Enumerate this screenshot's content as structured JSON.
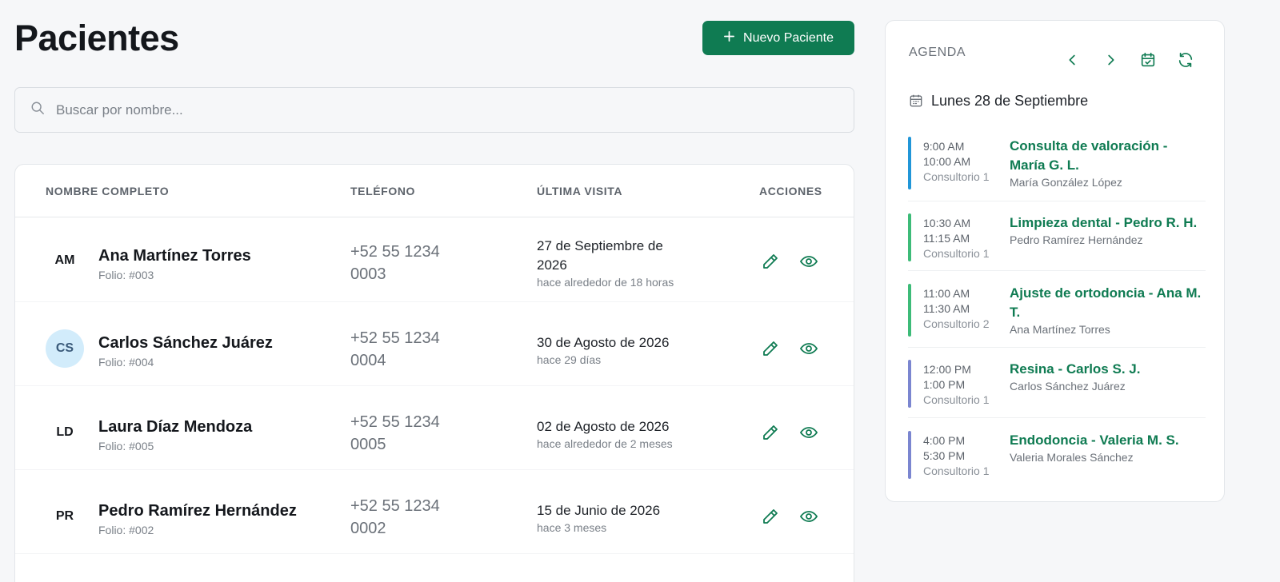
{
  "header": {
    "title": "Pacientes",
    "new_button_label": "Nuevo Paciente"
  },
  "search": {
    "placeholder": "Buscar por nombre...",
    "value": ""
  },
  "table": {
    "columns": [
      "NOMBRE COMPLETO",
      "TELÉFONO",
      "ÚLTIMA VISITA",
      "ACCIONES"
    ],
    "rows": [
      {
        "initials": "AM",
        "name": "Ana Martínez Torres",
        "folio": "Folio: #003",
        "phone_line1": "+52 55 1234",
        "phone_line2": "0003",
        "last_visit": "27 de Septiembre de 2026",
        "ago": "hace alrededor de 18 horas"
      },
      {
        "initials": "CS",
        "name": "Carlos Sánchez Juárez",
        "folio": "Folio: #004",
        "phone_line1": "+52 55 1234",
        "phone_line2": "0004",
        "last_visit": "30 de Agosto de 2026",
        "ago": "hace 29 días"
      },
      {
        "initials": "LD",
        "name": "Laura Díaz Mendoza",
        "folio": "Folio: #005",
        "phone_line1": "+52 55 1234",
        "phone_line2": "0005",
        "last_visit": "02 de Agosto de 2026",
        "ago": "hace alrededor de 2 meses"
      },
      {
        "initials": "PR",
        "name": "Pedro Ramírez Hernández",
        "folio": "Folio: #002",
        "phone_line1": "+52 55 1234",
        "phone_line2": "0002",
        "last_visit": "15 de Junio de 2026",
        "ago": "hace 3 meses"
      }
    ]
  },
  "agenda": {
    "title": "AGENDA",
    "date": "Lunes 28 de Septiembre",
    "appointments": [
      {
        "start": "9:00 AM",
        "end": "10:00 AM",
        "room": "Consultorio 1",
        "title": "Consulta de valoración - María G. L.",
        "patient": "María González López",
        "color": "#2196d8"
      },
      {
        "start": "10:30 AM",
        "end": "11:15 AM",
        "room": "Consultorio 1",
        "title": "Limpieza dental - Pedro R. H.",
        "patient": "Pedro Ramírez Hernández",
        "color": "#3dbb78"
      },
      {
        "start": "11:00 AM",
        "end": "11:30 AM",
        "room": "Consultorio 2",
        "title": "Ajuste de ortodoncia - Ana M. T.",
        "patient": "Ana Martínez Torres",
        "color": "#3dbb78"
      },
      {
        "start": "12:00 PM",
        "end": "1:00 PM",
        "room": "Consultorio 1",
        "title": "Resina - Carlos S. J.",
        "patient": "Carlos Sánchez Juárez",
        "color": "#7b86d0"
      },
      {
        "start": "4:00 PM",
        "end": "5:30 PM",
        "room": "Consultorio 1",
        "title": "Endodoncia - Valeria M. S.",
        "patient": "Valeria Morales Sánchez",
        "color": "#7b86d0"
      }
    ]
  },
  "colors": {
    "primary": "#0f7b52",
    "background": "#f6f7f9"
  },
  "icons": [
    "plus-icon",
    "search-icon",
    "pencil-icon",
    "eye-icon",
    "chevron-left-icon",
    "chevron-right-icon",
    "calendar-check-icon",
    "refresh-icon",
    "calendar-icon"
  ]
}
